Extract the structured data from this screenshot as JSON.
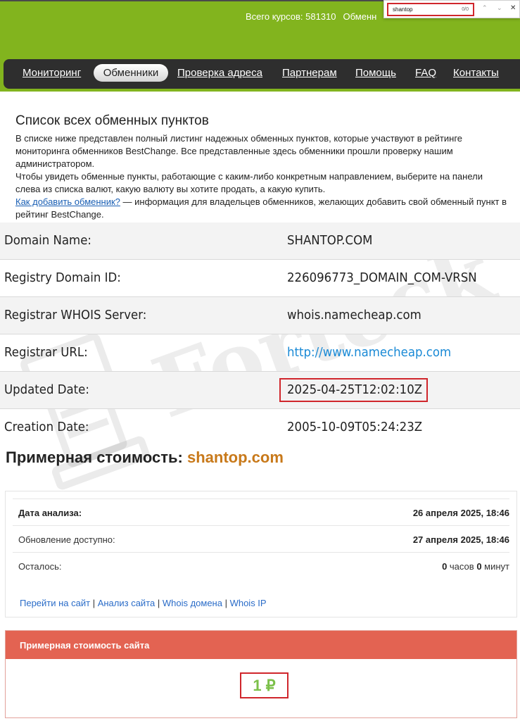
{
  "header": {
    "courses_label": "Всего курсов: 581310",
    "exchangers_label": "Обменн"
  },
  "findbar": {
    "query": "shantop",
    "count": "0/0",
    "prev_icon": "chevron-up-icon",
    "next_icon": "chevron-down-icon",
    "close_icon": "close-icon"
  },
  "nav": {
    "items": [
      {
        "label": "Мониторинг"
      },
      {
        "label": "Обменники"
      },
      {
        "label": "Проверка адреса"
      },
      {
        "label": "Партнерам"
      },
      {
        "label": "Помощь"
      },
      {
        "label": "FAQ"
      },
      {
        "label": "Контакты"
      }
    ],
    "active": "Обменники"
  },
  "intro": {
    "title": "Список всех обменных пунктов",
    "p1": "В списке ниже представлен полный листинг надежных обменных пунктов, которые участвуют в рейтинге мониторинга обменников BestChange. Все представленные здесь обменники прошли проверку нашим администратором.",
    "p2": "Чтобы увидеть обменные пункты, работающие с каким-либо конкретным направлением, выберите на панели слева из списка валют, какую валюту вы хотите продать, а какую купить.",
    "link": "Как добавить обменник?",
    "p3": " — информация для владельцев обменников, желающих добавить свой обменный пункт в рейтинг BestChange."
  },
  "whois": {
    "rows": [
      {
        "label": "Domain Name:",
        "value": "SHANTOP.COM"
      },
      {
        "label": "Registry Domain ID:",
        "value": "226096773_DOMAIN_COM-VRSN"
      },
      {
        "label": "Registrar WHOIS Server:",
        "value": "whois.namecheap.com"
      },
      {
        "label": "Registrar URL:",
        "value": "http://www.namecheap.com"
      },
      {
        "label": "Updated Date:",
        "value": "2025-04-25T12:02:10Z"
      },
      {
        "label": "Creation Date:",
        "value": "2005-10-09T05:24:23Z"
      }
    ]
  },
  "watermark": "Forteck",
  "price": {
    "heading": "Примерная стоимость: ",
    "domain": "shantop.com"
  },
  "analysis": {
    "rows": [
      {
        "label": "Дата анализа:",
        "value": "26 апреля 2025, 18:46"
      },
      {
        "label": "Обновление доступно:",
        "value": "27 апреля 2025, 18:46"
      }
    ],
    "remaining_label": "Осталось:",
    "remaining_hours": "0",
    "hours_unit": " часов ",
    "remaining_minutes": "0",
    "minutes_unit": " минут",
    "links": [
      "Перейти на сайт",
      "Анализ сайта",
      "Whois домена",
      "Whois IP"
    ],
    "separator": " | "
  },
  "cost": {
    "title": "Примерная стоимость сайта",
    "value": "1 ₽"
  },
  "colors": {
    "header_green": "#82b41e",
    "nav_dark": "#2e2e2e",
    "highlight_red": "#d0262c",
    "cost_header": "#e36352",
    "domain_orange": "#c8791a",
    "cost_green": "#7cc04a",
    "link_blue": "#2a6cc8"
  }
}
